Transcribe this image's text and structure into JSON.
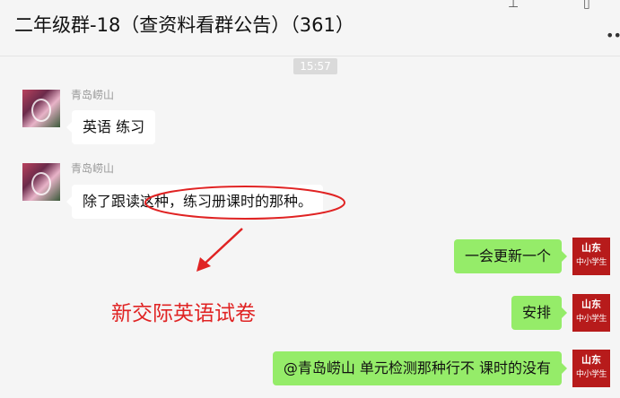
{
  "header": {
    "title": "二年级群-18（查资料看群公告）（361）",
    "pin_icon": "pin-icon",
    "minimize_icon": "minimize-icon",
    "more_icon": "more-icon"
  },
  "timestamp": "15:57",
  "messages": [
    {
      "side": "left",
      "sender": "青岛崂山",
      "text": "英语 练习",
      "avatar_icon": "user-avatar"
    },
    {
      "side": "left",
      "sender": "青岛崂山",
      "text": "除了跟读这种，练习册课时的那种。",
      "avatar_icon": "user-avatar"
    },
    {
      "side": "right",
      "text": "一会更新一个",
      "avatar": {
        "line1": "山东",
        "line2": "中小学生"
      }
    },
    {
      "side": "right",
      "text": "安排",
      "avatar": {
        "line1": "山东",
        "line2": "中小学生"
      }
    },
    {
      "side": "right",
      "text": "@青岛崂山 单元检测那种行不  课时的没有",
      "avatar": {
        "line1": "山东",
        "line2": "中小学生"
      }
    }
  ],
  "annotation": {
    "text": "新交际英语试卷",
    "color": "#e02323"
  },
  "colors": {
    "background": "#f5f5f5",
    "bubble_incoming": "#ffffff",
    "bubble_outgoing": "#95ec69",
    "avatar_brand": "#b71b1b"
  }
}
